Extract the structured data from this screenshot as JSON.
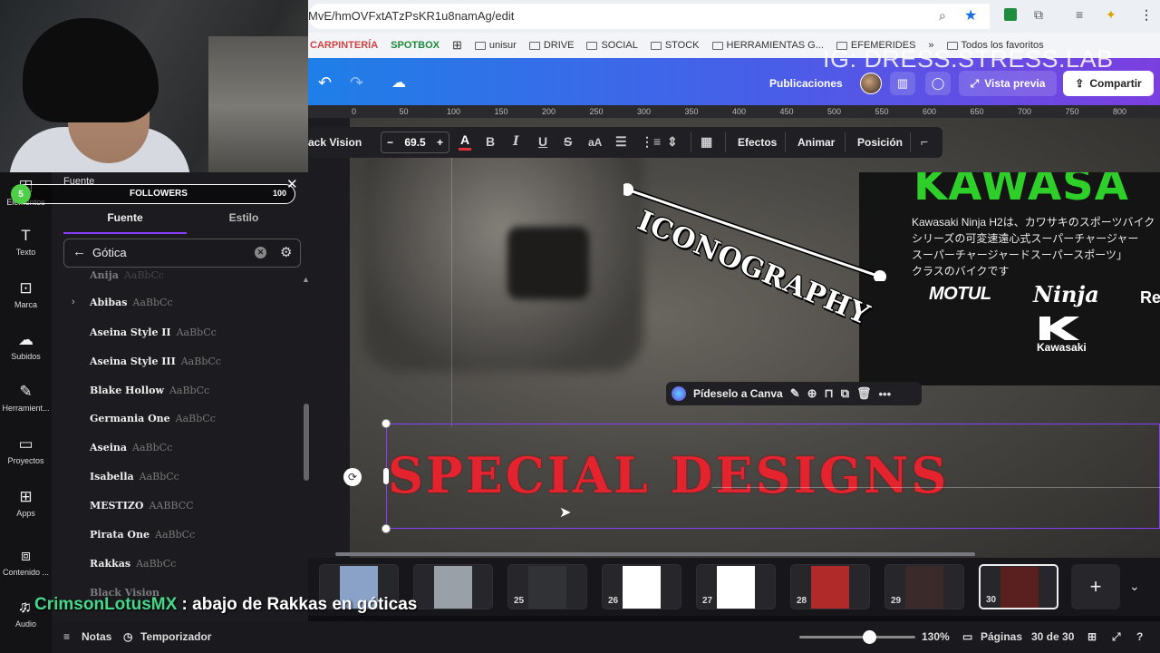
{
  "browser": {
    "url": "MvE/hmOVFxtATzPsKR1u8namAg/edit",
    "bookmarks": [
      "CARPINTERÍA",
      "SPOTBOX",
      "unisur",
      "DRIVE",
      "SOCIAL",
      "STOCK",
      "HERRAMIENTAS G...",
      "EFEMERIDES",
      "Todos los favoritos"
    ],
    "overflow": "»"
  },
  "watermark": "IG: DRESS.STRESS.LAB",
  "header": {
    "publicaciones": "Publicaciones",
    "preview": "Vista previa",
    "share": "Compartir"
  },
  "ruler": [
    "0",
    "50",
    "100",
    "150",
    "200",
    "250",
    "300",
    "350",
    "400",
    "450",
    "500",
    "550",
    "600",
    "650",
    "700",
    "750",
    "800"
  ],
  "text_toolbar": {
    "font": "ack Vision",
    "size": "69.5",
    "effects": "Efectos",
    "animate": "Animar",
    "position": "Posición"
  },
  "canvas": {
    "iconography": "ICONOGRAPHY",
    "kawasaki_title": "KAWASA",
    "kawasaki_desc": "Kawasaki Ninja H2は、カワサキのスポーツバイク\nシリーズの可変速遠心式スーパーチャージャー\nスーパーチャージャードスーパースポーツ」\nクラスのバイクです",
    "motul": "MOTUL",
    "ninja": "Ninja",
    "re": "Re",
    "kawasaki_logo": "Kawasaki",
    "special": "SPECIAL DESIGNS",
    "ctx_label": "Pídeselo a Canva"
  },
  "thumbs": [
    {
      "num": "",
      "color": "#8aa2c8"
    },
    {
      "num": "",
      "color": "#9aa0a8"
    },
    {
      "num": "25",
      "color": "#303236"
    },
    {
      "num": "26",
      "color": "#ffffff"
    },
    {
      "num": "27",
      "color": "#ffffff"
    },
    {
      "num": "28",
      "color": "#b12a2a"
    },
    {
      "num": "29",
      "color": "#3a2a2a"
    },
    {
      "num": "30",
      "color": "#5a2020"
    }
  ],
  "status": {
    "notes": "Notas",
    "timer": "Temporizador",
    "zoom": "130%",
    "zoom_level": 0.6,
    "pages": "Páginas",
    "page_count": "30 de 30"
  },
  "rail": [
    {
      "label": "Elementos",
      "icon": "elements-icon"
    },
    {
      "label": "Texto",
      "icon": "text-icon"
    },
    {
      "label": "Marca",
      "icon": "brand-icon"
    },
    {
      "label": "Subidos",
      "icon": "upload-icon"
    },
    {
      "label": "Herramient...",
      "icon": "tools-icon"
    },
    {
      "label": "Proyectos",
      "icon": "folder-icon"
    },
    {
      "label": "Apps",
      "icon": "apps-icon"
    },
    {
      "label": "Contenido ...",
      "icon": "content-icon"
    },
    {
      "label": "Audio",
      "icon": "audio-icon"
    }
  ],
  "panel": {
    "title": "Fuente",
    "followers_label": "FOLLOWERS",
    "followers_count": "100",
    "followers_badge": "5",
    "tab_font": "Fuente",
    "tab_style": "Estilo",
    "search": "Gótica",
    "fonts": [
      {
        "name": "Anija",
        "sample": "AaBbCc"
      },
      {
        "name": "Abibas",
        "sample": "AaBbCc"
      },
      {
        "name": "Aseina Style II",
        "sample": "AaBbCc"
      },
      {
        "name": "Aseina Style III",
        "sample": "AaBbCc"
      },
      {
        "name": "Blake Hollow",
        "sample": "AaBbCc"
      },
      {
        "name": "Germania One",
        "sample": "AaBbCc"
      },
      {
        "name": "Aseina",
        "sample": "AaBbCc"
      },
      {
        "name": "Isabella",
        "sample": "AaBbCc"
      },
      {
        "name": "MESTIZO",
        "sample": "AABBCC"
      },
      {
        "name": "Pirata One",
        "sample": "AaBbCc"
      },
      {
        "name": "Rakkas",
        "sample": "AaBbCc"
      },
      {
        "name": "Black Vision",
        "sample": ""
      }
    ]
  },
  "chat": {
    "user": "CrimsonLotusMX",
    "message": " : abajo de Rakkas en góticas"
  }
}
